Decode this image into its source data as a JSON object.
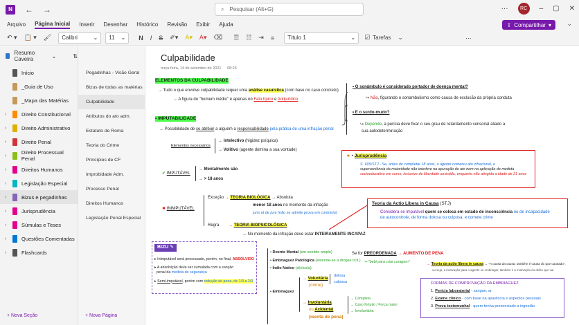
{
  "titlebar": {
    "logo": "N",
    "back_icon": "back-arrow-icon",
    "forward_icon": "forward-arrow-icon",
    "search_placeholder": "Pesquisar (Alt+G)",
    "avatar": "RC"
  },
  "menu": {
    "items": [
      "Arquivo",
      "Página Inicial",
      "Inserir",
      "Desenhar",
      "Histórico",
      "Revisão",
      "Exibir",
      "Ajuda"
    ],
    "share": "Compartilhar"
  },
  "ribbon": {
    "font": "Calibri",
    "size": "11",
    "style": "Título 1",
    "tasks": "Tarefas",
    "bold": "N",
    "italic": "I",
    "strike": "S"
  },
  "notebook": {
    "name": "Resumo Caveira",
    "sections": [
      {
        "label": "Início",
        "color": "#555555"
      },
      {
        "label": "_Guia de Uso",
        "color": "#c49a5c"
      },
      {
        "label": "_Mapa das Matérias",
        "color": "#c49a5c"
      },
      {
        "label": "Direito Constitucional",
        "color": "#ff8c00"
      },
      {
        "label": "Direito Administrativo",
        "color": "#e0b000"
      },
      {
        "label": "Direito Penal",
        "color": "#d13438"
      },
      {
        "label": "Direito Processual Penal",
        "color": "#8cbd18"
      },
      {
        "label": "Direitos Humanos",
        "color": "#e3008c"
      },
      {
        "label": "Legislação Especial",
        "color": "#00b7c3"
      },
      {
        "label": "Bizus e pegadinhas",
        "color": "#8764b8"
      },
      {
        "label": "Jurisprudência",
        "color": "#e3008c"
      },
      {
        "label": "Súmulas e Teses",
        "color": "#e3008c"
      },
      {
        "label": "Questões Comentadas",
        "color": "#0078d4"
      },
      {
        "label": "Flashcards",
        "color": "#555555"
      }
    ],
    "new_section": "Nova Seção"
  },
  "pages": {
    "items": [
      "Pegadinhas - Visão Geral",
      "Bizus de todas as matérias",
      "Culpabilidade",
      "Atributos do ato adm.",
      "Estatuto de Roma",
      "Teoria do Crime",
      "Princípios de CF",
      "Improbidade Adm.",
      "Processo Penal",
      "Direitos Humanos",
      "Legislação Penal Especial"
    ],
    "new_page": "Nova Página"
  },
  "note": {
    "title": "Culpabilidade",
    "date": "terça-feira, 14 de setembro de 2021",
    "time": "08:26",
    "elements_heading": "ELEMENTOS DA CULPABILIDADE",
    "elements_line": "Tudo o que envolve culpabilidade requer uma",
    "analise": "análise casuística",
    "analise_rest": "(com base no caso concreto)",
    "figura": "A figura do \"homem médio\" é apenas no",
    "fato_tipico": "Fato típico",
    "antijuridico": "Antijurídico",
    "q1": "O sonâmbulo é considerado portador de doença mental?",
    "a1_no": "Não",
    "a1_rest": ", figurando o sonambulismo como causa de exclusão da própria conduta",
    "q2": "E o surdo-mudo?",
    "a2_dep": "Depende",
    "a2_rest": ", a perícia deve fixar o seu grau de retardamento sensorial aliado a",
    "a2_rest2": "sua autodeterminação",
    "imputabilidade": "IMPUTABILIDADE",
    "possib": "Possibilidade de",
    "se_atribuir": "se atribuir",
    "possib2": "a alguém a",
    "responsab": "responsabilidade",
    "possib3": "pela prática de uma infração penal",
    "elem_nec": "Elementos necessários",
    "intelectivo": "Intelectivo",
    "intelectivo_rest": "(higidez psíquica)",
    "volitivo": "Volitivo",
    "volitivo_rest": "(agente domina a sua vontade)",
    "imputavel": "IMPUTÁVEL",
    "mental": "Mentalmente são",
    "maior18": "> 18 anos",
    "inimputavel": "INIMPUTÁVEL",
    "excecao": "Exceção",
    "teoria_bio": "TEORIA BIOLÓGICA",
    "absoluta": "Absoluta",
    "menor18": "menor 18 anos",
    "menor18_rest": "no momento da infração",
    "juris": "juris et de jure (não se admite prova em contrário)",
    "regra": "Regra",
    "teoria_biopsi": "TEORIA BIOPSICOLÓGICA",
    "momento": "No momento da infração deve estar",
    "inteiramente": "INTEIRAMENTE INCAPAZ",
    "jurisp_title": "Jurisprudência",
    "jurisp_text1": "S. 605/STJ - Se, antes de completar 18 anos, o agente cometeu ato infracional, a",
    "jurisp_text2": "superveniência da maioridade não interfere na apuração do ato nem na aplicação de medida",
    "jurisp_text3": "socioeducativa em curso, inclusive de liberdade assistida, enquanto não atingida a idade de 21 anos",
    "actio_title": "Teoria da Actio Libera in Causa",
    "actio_stj": "(STJ)",
    "actio_text1": "Considera-se imputável",
    "actio_text1b": "quem se coloca em estado de inconsciência",
    "actio_text1c": "ou de incapacidade",
    "actio_text2": "de autocontrole, de forma dolosa ou culposa, e comete crime",
    "bizu": "BIZU",
    "bizu1": "Inimputável será processado, porém, no final,",
    "bizu1b": "ABSOLVIDO",
    "bizu2": "A absolvição deve ser cumulada com a sanção",
    "bizu2b": "penal da",
    "bizu2c": "medida de segurança",
    "bizu3": "Semi-imputável",
    "bizu3b": ", porém com",
    "bizu3c": "redução de pena, de 1/3 a 2/3",
    "doente": "Doente Mental",
    "doente_rest": "(em sentido amplo)",
    "embrpat": "Embriaguez Patológica",
    "embrpat_rest": "(estende-se a drogas lícit.)",
    "indio": "Índio Nativo",
    "indio_rest": "(silvícola)",
    "embriaguez": "Embriaguez",
    "voluntaria": "Voluntária",
    "crime": "(crime)",
    "dolosa": "dolosa",
    "culposa": "culposa",
    "involuntaria": "Involuntária",
    "ou": "ou",
    "acidental": "Acidental",
    "isenta": "(isenta de pena)",
    "completa": "Completa",
    "caso": "Caso fortuito / Força maior",
    "involunt2": "Involuntária",
    "se_for": "Se for",
    "preordenada": "PREORDENADA",
    "aumento": "AUMENTO DE PENA",
    "bebi": "\"bebi para criar coragem\"",
    "teoria_actio2": "Teoria da actio libera in causa",
    "actio2_note": "→ \"A causa da causa, também é causa do que causado\",",
    "actio2_note2": "ou seja, a motivação para o agente se embriagar, também é a motivação do delito que vai",
    "formas_title": "FORMAS DE COMPROVAÇÃO DA EMBRIAGUEZ",
    "formas": [
      {
        "n": "1.",
        "name": "Perícia laboratorial",
        "rest": "- sangue, ar"
      },
      {
        "n": "2.",
        "name": "Exame clínico",
        "rest": "- com base na aparência e aspectos pessoais"
      },
      {
        "n": "3.",
        "name": "Prova testemunhal",
        "rest": "- quem tenha presenciado a ingestão"
      }
    ]
  },
  "colors": {
    "accent": "#7719aa",
    "red": "#e01818",
    "green_highlight": "#4cff4c",
    "yellow_highlight": "#ffff4c",
    "blue": "#1a6fdc"
  }
}
